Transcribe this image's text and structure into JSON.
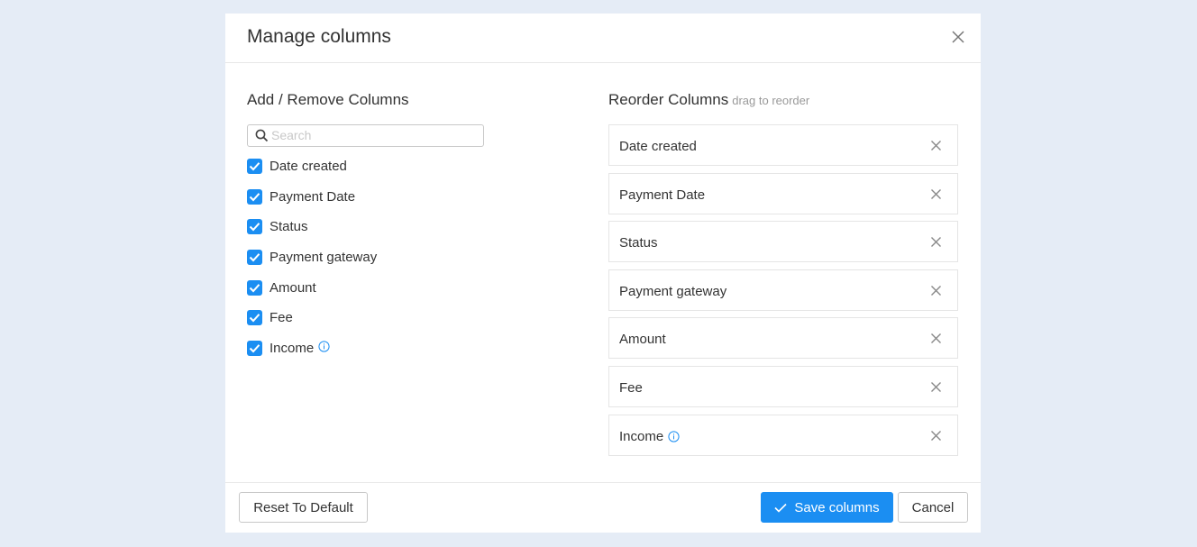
{
  "modal": {
    "title": "Manage columns",
    "close_icon": "close-icon"
  },
  "left_panel": {
    "title": "Add / Remove Columns",
    "search": {
      "placeholder": "Search",
      "value": "",
      "icon": "search-icon"
    },
    "columns": [
      {
        "label": "Date created",
        "checked": true,
        "info": false
      },
      {
        "label": "Payment Date",
        "checked": true,
        "info": false
      },
      {
        "label": "Status",
        "checked": true,
        "info": false
      },
      {
        "label": "Payment gateway",
        "checked": true,
        "info": false
      },
      {
        "label": "Amount",
        "checked": true,
        "info": false
      },
      {
        "label": "Fee",
        "checked": true,
        "info": false
      },
      {
        "label": "Income",
        "checked": true,
        "info": true
      }
    ]
  },
  "right_panel": {
    "title": "Reorder Columns",
    "hint": "drag to reorder",
    "items": [
      {
        "label": "Date created",
        "info": false
      },
      {
        "label": "Payment Date",
        "info": false
      },
      {
        "label": "Status",
        "info": false
      },
      {
        "label": "Payment gateway",
        "info": false
      },
      {
        "label": "Amount",
        "info": false
      },
      {
        "label": "Fee",
        "info": false
      },
      {
        "label": "Income",
        "info": true
      }
    ]
  },
  "footer": {
    "reset_label": "Reset To Default",
    "save_label": "Save columns",
    "cancel_label": "Cancel"
  },
  "colors": {
    "accent": "#1b8ef2",
    "background": "#e5ecf6",
    "info_icon": "#1b8ef2"
  }
}
